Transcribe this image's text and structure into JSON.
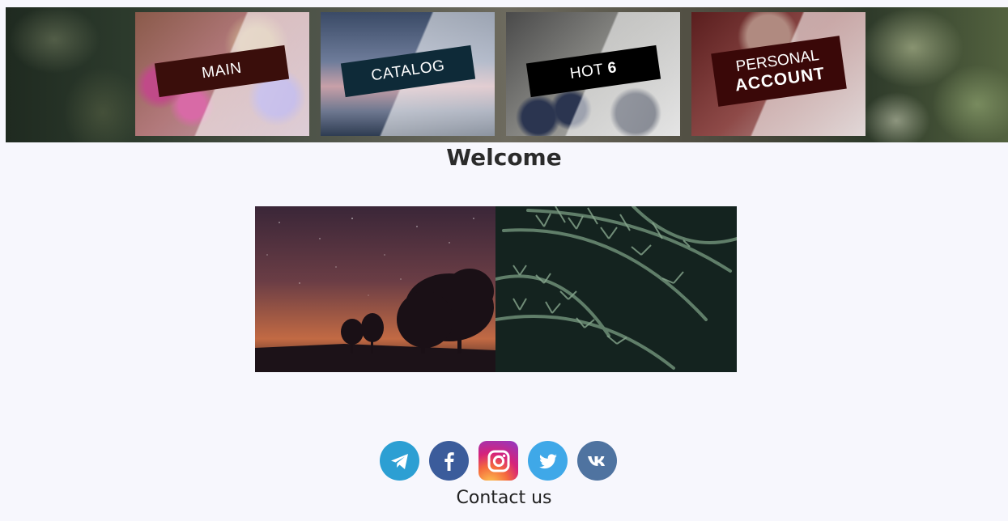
{
  "nav": {
    "main": "MAIN",
    "catalog": "CATALOG",
    "hot_prefix": "HOT",
    "hot_number": "6",
    "account_line1": "PERSONAL",
    "account_line2": "ACCOUNT"
  },
  "main": {
    "title": "Welcome"
  },
  "social": {
    "icons": [
      "telegram-icon",
      "facebook-icon",
      "instagram-icon",
      "twitter-icon",
      "vk-icon"
    ]
  },
  "footer": {
    "contact": "Contact us"
  },
  "colors": {
    "background": "#f7f7fd",
    "banner_main": "#3a0e0b",
    "banner_catalog": "#0e2a38",
    "banner_hot": "#000000",
    "banner_account": "#3a0808"
  }
}
